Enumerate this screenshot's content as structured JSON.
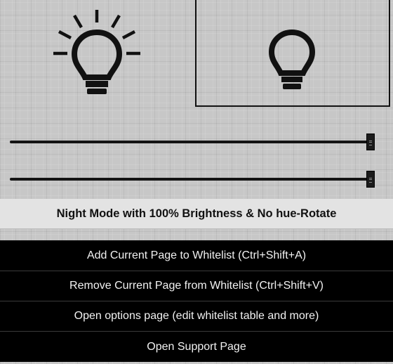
{
  "status": {
    "text": "Night Mode with 100% Brightness & No hue-Rotate"
  },
  "sliders": [
    {
      "name": "brightness",
      "value": 1.0
    },
    {
      "name": "hue-rotate",
      "value": 1.0
    }
  ],
  "menu": [
    {
      "label": "Add Current Page to Whitelist (Ctrl+Shift+A)"
    },
    {
      "label": "Remove Current Page from Whitelist (Ctrl+Shift+V)"
    },
    {
      "label": "Open options page (edit whitelist table and more)"
    },
    {
      "label": "Open Support Page"
    }
  ],
  "icons": {
    "light_on": "lightbulb-on-icon",
    "light_off": "lightbulb-off-icon"
  },
  "colors": {
    "menu_bg": "#000000",
    "menu_text": "#f2f2f2",
    "status_bg": "#e3e3e3"
  }
}
